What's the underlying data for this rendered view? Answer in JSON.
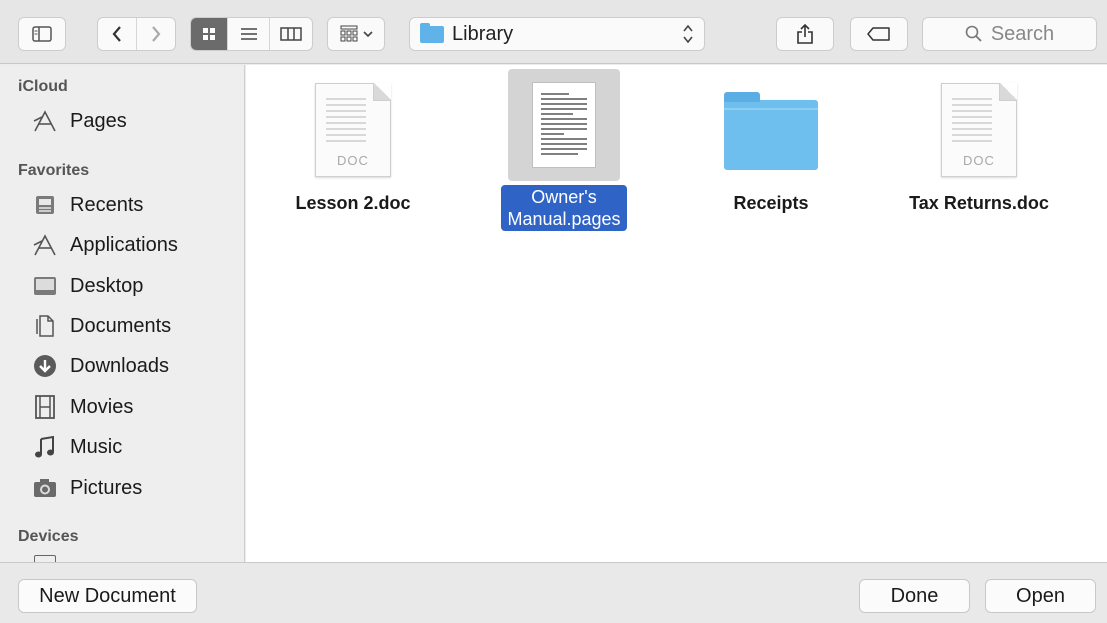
{
  "toolbar": {
    "path_label": "Library",
    "search_placeholder": "Search"
  },
  "sidebar": {
    "sections": {
      "icloud": "iCloud",
      "favorites": "Favorites",
      "devices": "Devices"
    },
    "icloud_items": [
      {
        "label": "Pages",
        "icon": "pages-icon"
      }
    ],
    "favorite_items": [
      {
        "label": "Recents",
        "icon": "recents-icon"
      },
      {
        "label": "Applications",
        "icon": "applications-icon"
      },
      {
        "label": "Desktop",
        "icon": "desktop-icon"
      },
      {
        "label": "Documents",
        "icon": "documents-icon"
      },
      {
        "label": "Downloads",
        "icon": "downloads-icon"
      },
      {
        "label": "Movies",
        "icon": "movies-icon"
      },
      {
        "label": "Music",
        "icon": "music-icon"
      },
      {
        "label": "Pictures",
        "icon": "pictures-icon"
      }
    ]
  },
  "files": [
    {
      "name": "Lesson 2.doc",
      "kind": "doc",
      "badge": "DOC",
      "selected": false
    },
    {
      "name_line1": "Owner's",
      "name_line2": "Manual.pages",
      "kind": "pages",
      "selected": true
    },
    {
      "name": "Receipts",
      "kind": "folder",
      "selected": false
    },
    {
      "name": "Tax Returns.doc",
      "kind": "doc",
      "badge": "DOC",
      "selected": false
    }
  ],
  "bottom": {
    "new_document": "New Document",
    "done": "Done",
    "open": "Open"
  },
  "colors": {
    "selection": "#2f63c6",
    "folder": "#6fbfee"
  }
}
